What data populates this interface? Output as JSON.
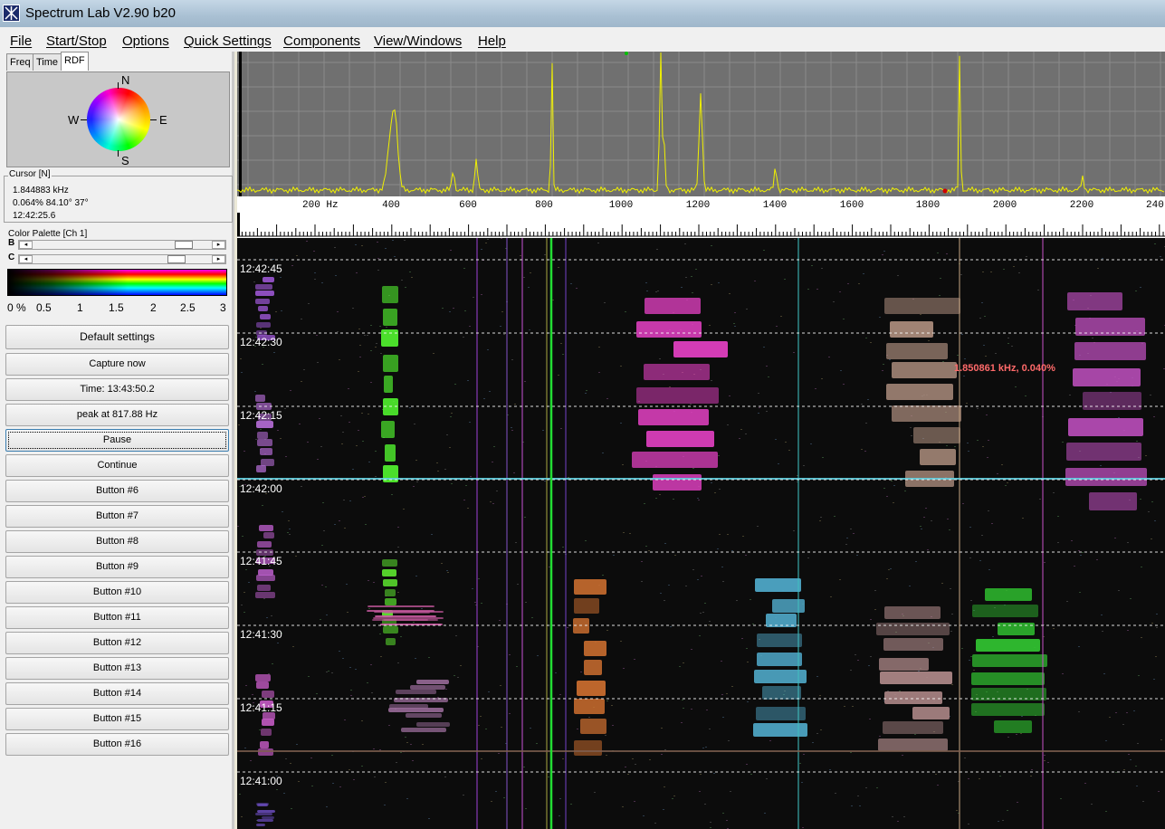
{
  "window": {
    "title": "Spectrum Lab V2.90 b20"
  },
  "menu": [
    "File",
    "Start/Stop",
    "Options",
    "Quick Settings",
    "Components",
    "View/Windows",
    "Help"
  ],
  "tabs": [
    "Freq",
    "Time",
    "RDF"
  ],
  "compass": {
    "n": "N",
    "s": "S",
    "e": "E",
    "w": "W"
  },
  "cursor": {
    "title": "Cursor [N]",
    "freq": "1.844883 kHz",
    "level": "0.064% 84.10°  37°",
    "time": "12:42:25.6"
  },
  "color_palette": {
    "title": "Color Palette [Ch 1]",
    "b_label": "B",
    "c_label": "C",
    "scale": [
      "0 %",
      "0.5",
      "1",
      "1.5",
      "2",
      "2.5",
      "3"
    ]
  },
  "buttons": [
    "Default settings",
    "Capture now",
    "Time:  13:43:50.2",
    "peak at 817.88 Hz",
    "Pause",
    "Continue",
    "Button #6",
    "Button #7",
    "Button #8",
    "Button #9",
    "Button #10",
    "Button #11",
    "Button #12",
    "Button #13",
    "Button #14",
    "Button #15",
    "Button #16"
  ],
  "freq_axis": [
    "200 Hz",
    "400",
    "600",
    "800",
    "1000",
    "1200",
    "1400",
    "1600",
    "1800",
    "2000",
    "2200",
    "240"
  ],
  "waterfall": {
    "time_labels": [
      "12:42:45",
      "12:42:30",
      "12:42:15",
      "12:42:00",
      "12:41:45",
      "12:41:30",
      "12:41:15",
      "12:41:00"
    ],
    "cursor_readout": "1.850861 kHz, 0.040%"
  },
  "colors": {
    "spectrum_trace": "#f0f000",
    "spectrum_bg": "#707070",
    "waterfall_bg": "#0c0c0c",
    "cursor_line": "#22dd33"
  }
}
